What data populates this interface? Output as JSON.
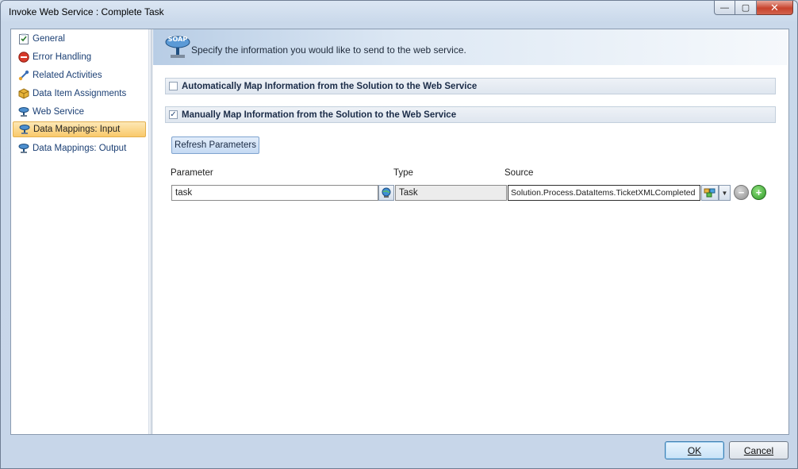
{
  "window": {
    "title": "Invoke Web Service : Complete Task"
  },
  "titlebar_buttons": {
    "minimize": "—",
    "maximize": "▢",
    "close": "✕"
  },
  "nav": {
    "items": [
      {
        "label": "General",
        "icon": "checklist-icon"
      },
      {
        "label": "Error Handling",
        "icon": "error-icon"
      },
      {
        "label": "Related Activities",
        "icon": "link-icon"
      },
      {
        "label": "Data Item Assignments",
        "icon": "cube-icon"
      },
      {
        "label": "Web Service",
        "icon": "soap-icon"
      },
      {
        "label": "Data Mappings: Input",
        "icon": "soap-icon",
        "selected": true
      },
      {
        "label": "Data Mappings: Output",
        "icon": "soap-icon"
      }
    ]
  },
  "header": {
    "soap_label": "SOAP",
    "text": "Specify the information you would like to send to the web service."
  },
  "sections": {
    "auto_map": {
      "label": "Automatically Map Information from the Solution to the Web Service",
      "checked": false
    },
    "manual_map": {
      "label": "Manually Map Information from the Solution to the Web Service",
      "checked": true
    }
  },
  "refresh_button": "Refresh Parameters",
  "table": {
    "columns": [
      "Parameter",
      "Type",
      "Source"
    ],
    "rows": [
      {
        "parameter": "task",
        "type": "Task",
        "source": "Solution.Process.DataItems.TicketXMLCompleted"
      }
    ]
  },
  "footer": {
    "ok": "OK",
    "cancel": "Cancel"
  }
}
